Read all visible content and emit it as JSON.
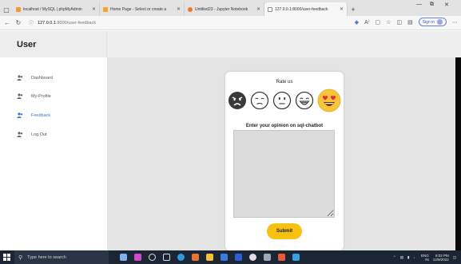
{
  "browser": {
    "tabs": [
      {
        "label": "localhost / MySQL | phpMyAdmin",
        "favicon_color": "#f29b2e"
      },
      {
        "label": "Home Page - Select or create a",
        "favicon_color": "#f5a623"
      },
      {
        "label": "Untitled23 - Jupyter Notebook",
        "favicon_color": "#f37726"
      },
      {
        "label": "127.0.0.1:8000/user-feedback",
        "favicon_color": "#888888"
      }
    ],
    "url_host": "127.0.0.1",
    "url_path": ":8000/user-feedback",
    "signin_label": "Sign in"
  },
  "app": {
    "title": "User",
    "nav": [
      {
        "label": "Dashboard"
      },
      {
        "label": "My-Profile"
      },
      {
        "label": "Feedback"
      },
      {
        "label": "Log Out"
      }
    ],
    "active_nav": "Feedback"
  },
  "feedback": {
    "rate_label": "Rate us",
    "emojis": [
      "angry-face-icon",
      "sad-face-icon",
      "neutral-face-icon",
      "grinning-face-icon",
      "heart-eyes-face-icon"
    ],
    "selected_emoji": "heart-eyes-face-icon",
    "opinion_label": "Enter your opinion on sql-chatbot",
    "textarea_value": "",
    "submit_label": "Submit"
  },
  "taskbar": {
    "search_placeholder": "Type here to search",
    "language": "ENG",
    "region": "IN",
    "time": "8:02 PM",
    "date": "12/9/2022"
  },
  "colors": {
    "accent": "#f7c111",
    "active_nav": "#3a78c9",
    "main_bg": "#e4e4e4"
  }
}
